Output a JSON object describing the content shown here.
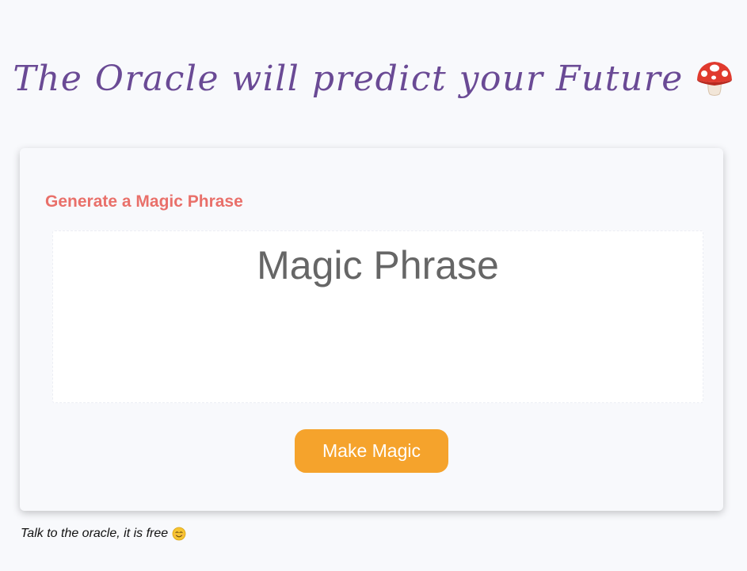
{
  "header": {
    "title": "The Oracle will predict your Future",
    "icon": "mushroom-icon"
  },
  "card": {
    "heading": "Generate a Magic Phrase",
    "phrase_placeholder": "Magic Phrase",
    "button_label": "Make Magic"
  },
  "footer": {
    "text": "Talk to the oracle, it is free",
    "icon": "smile-icon"
  },
  "colors": {
    "title": "#6a4a95",
    "heading": "#e9706a",
    "button": "#f5a32c",
    "background": "#f8f9fc"
  }
}
